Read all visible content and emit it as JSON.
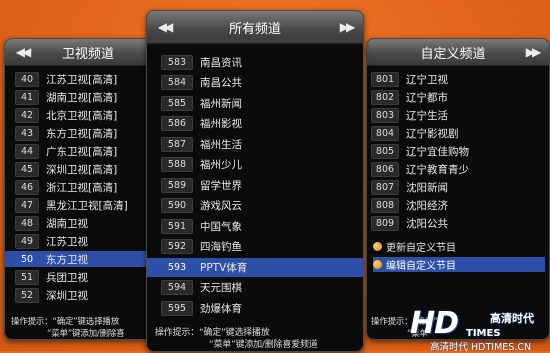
{
  "left_panel": {
    "title": "卫视频道",
    "prev_arrow": "◀◀",
    "channels": [
      {
        "num": "40",
        "name": "江苏卫视[高清]"
      },
      {
        "num": "41",
        "name": "湖南卫视[高清]"
      },
      {
        "num": "42",
        "name": "北京卫视[高清]"
      },
      {
        "num": "43",
        "name": "东方卫视[高清]"
      },
      {
        "num": "44",
        "name": "广东卫视[高清]"
      },
      {
        "num": "45",
        "name": "深圳卫视[高清]"
      },
      {
        "num": "46",
        "name": "浙江卫视[高清]"
      },
      {
        "num": "47",
        "name": "黑龙江卫视[高清]"
      },
      {
        "num": "48",
        "name": "湖南卫视"
      },
      {
        "num": "49",
        "name": "江苏卫视"
      },
      {
        "num": "50",
        "name": "东方卫视",
        "selected": true
      },
      {
        "num": "51",
        "name": "兵团卫视"
      },
      {
        "num": "52",
        "name": "深圳卫视"
      }
    ],
    "tip_line": "操作提示：“确定”键选择播放",
    "tip_line2": "“菜单”键添加/删除喜"
  },
  "center_panel": {
    "title": "所有频道",
    "prev_arrow": "◀◀",
    "next_arrow": "▶▶",
    "channels": [
      {
        "num": "583",
        "name": "南昌资讯"
      },
      {
        "num": "584",
        "name": "南昌公共"
      },
      {
        "num": "585",
        "name": "福州新闻"
      },
      {
        "num": "586",
        "name": "福州影视"
      },
      {
        "num": "587",
        "name": "福州生活"
      },
      {
        "num": "588",
        "name": "福州少儿"
      },
      {
        "num": "589",
        "name": "留学世界"
      },
      {
        "num": "590",
        "name": "游戏风云"
      },
      {
        "num": "591",
        "name": "中国气象"
      },
      {
        "num": "592",
        "name": "四海钓鱼"
      },
      {
        "num": "593",
        "name": "PPTV体育",
        "selected": true
      },
      {
        "num": "594",
        "name": "天元围棋"
      },
      {
        "num": "595",
        "name": "劲爆体育"
      }
    ],
    "tip_line1": "操作提示：“确定”键选择播放",
    "tip_line2": "“菜单”键添加/删除喜爱频道"
  },
  "right_panel": {
    "title": "自定义频道",
    "next_arrow": "▶▶",
    "channels": [
      {
        "num": "801",
        "name": "辽宁卫视"
      },
      {
        "num": "802",
        "name": "辽宁都市"
      },
      {
        "num": "803",
        "name": "辽宁生活"
      },
      {
        "num": "804",
        "name": "辽宁影视剧"
      },
      {
        "num": "805",
        "name": "辽宁宜佳购物"
      },
      {
        "num": "806",
        "name": "辽宁教育青少"
      },
      {
        "num": "807",
        "name": "沈阳新闻"
      },
      {
        "num": "808",
        "name": "沈阳经济"
      },
      {
        "num": "809",
        "name": "沈阳公共"
      }
    ],
    "actions": [
      {
        "label": "更新自定义节目"
      },
      {
        "label": "编辑自定义节目",
        "selected": true
      }
    ],
    "tip_line1": "操作提示：“确定”",
    "tip_line2": "“菜单”"
  },
  "logo": {
    "hd": "HD",
    "times": "TIMES",
    "cn": "高清时代",
    "url": "高清时代 HDTIMES.CN"
  },
  "colors": {
    "background": "#e96a1a",
    "panel": "#0b0b0b",
    "selection": "#2d4fa8",
    "header": "#5a5a5a"
  }
}
